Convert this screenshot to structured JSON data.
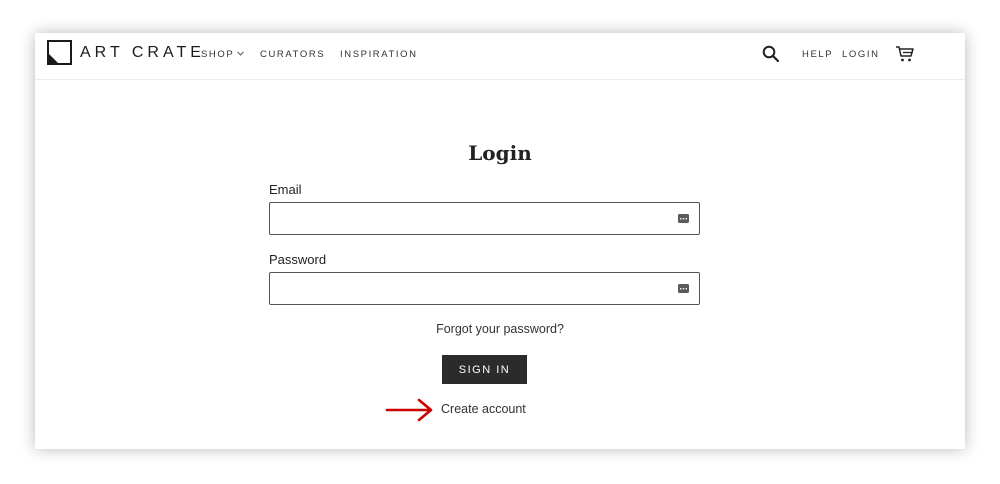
{
  "brand": {
    "name": "ART CRATE"
  },
  "nav": {
    "left": [
      {
        "label": "SHOP",
        "has_dropdown": true
      },
      {
        "label": "CURATORS"
      },
      {
        "label": "INSPIRATION"
      }
    ],
    "right": {
      "help": "HELP",
      "login": "LOGIN"
    },
    "icons": [
      "search-icon",
      "cart-icon"
    ]
  },
  "login_form": {
    "title": "Login",
    "email_label": "Email",
    "email_value": "",
    "password_label": "Password",
    "password_value": "",
    "forgot_link": "Forgot your password?",
    "submit_label": "SIGN IN",
    "create_account_link": "Create account",
    "field_icon": "password-manager-key-icon"
  },
  "colors": {
    "button_bg": "#2b2b2b",
    "annotation_arrow": "#cc0000",
    "text": "#222222"
  }
}
